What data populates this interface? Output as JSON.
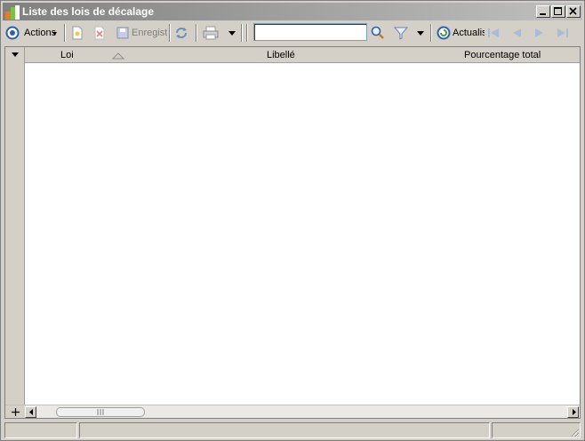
{
  "window": {
    "title": "Liste des lois de décalage",
    "accent": "#808080"
  },
  "toolbar": {
    "actions_label": "Actions",
    "save_label": "Enregist",
    "search_value": "",
    "refresh_label": "Actualis"
  },
  "grid": {
    "columns": [
      {
        "label": "Loi",
        "sort": "ascending"
      },
      {
        "label": "Libellé"
      },
      {
        "label": "Pourcentage total"
      }
    ],
    "rows": []
  },
  "status": {
    "panels": [
      "",
      "",
      ""
    ]
  }
}
